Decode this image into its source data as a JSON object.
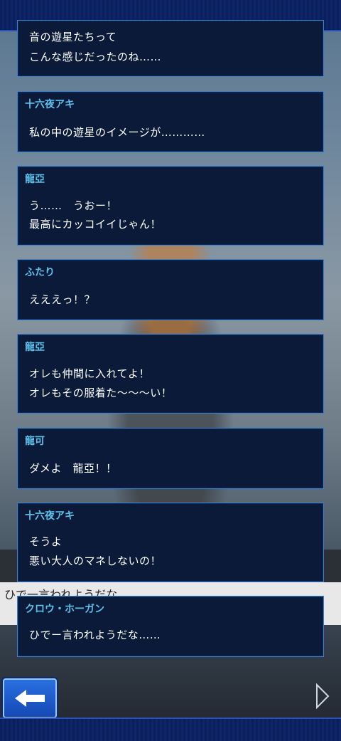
{
  "log": [
    {
      "speaker": "",
      "lines": [
        "音の遊星たちって",
        "こんな感じだったのね……"
      ]
    },
    {
      "speaker": "十六夜アキ",
      "lines": [
        "私の中の遊星のイメージが…………"
      ]
    },
    {
      "speaker": "龍亞",
      "lines": [
        "う……　うおー！",
        "最高にカッコイイじゃん！"
      ]
    },
    {
      "speaker": "ふたり",
      "lines": [
        "えええっ！？"
      ]
    },
    {
      "speaker": "龍亞",
      "lines": [
        "オレも仲間に入れてよ！",
        "オレもその服着た〜〜〜い！"
      ]
    },
    {
      "speaker": "龍可",
      "lines": [
        "ダメよ　龍亞！！"
      ]
    },
    {
      "speaker": "十六夜アキ",
      "lines": [
        "そうよ",
        "悪い大人のマネしないの！"
      ]
    },
    {
      "speaker": "クロウ・ホーガン",
      "lines": [
        "ひでー言われようだな……"
      ]
    }
  ],
  "background_text": "ひで一言われようだな",
  "icons": {
    "back": "left-arrow-icon",
    "next": "right-chevron-icon"
  },
  "colors": {
    "speaker": "#5fc1ea",
    "panel": "#0a1a38",
    "border": "#3f7ec9",
    "button": "#1d5fd0"
  }
}
